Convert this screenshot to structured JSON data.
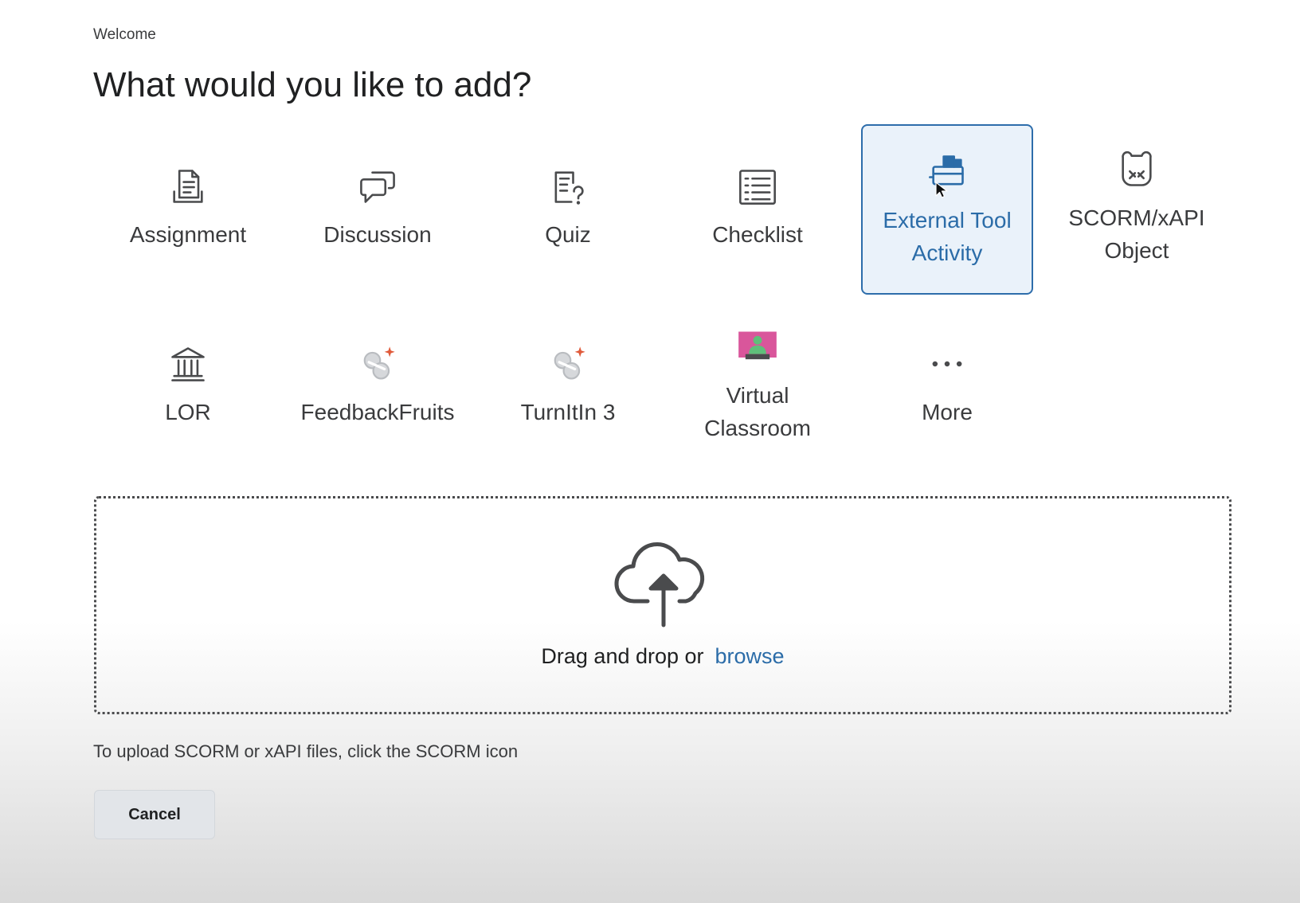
{
  "breadcrumb": "Welcome",
  "title": "What would you like to add?",
  "tiles": [
    {
      "label": "Assignment",
      "icon": "assignment-icon",
      "selected": false
    },
    {
      "label": "Discussion",
      "icon": "discussion-icon",
      "selected": false
    },
    {
      "label": "Quiz",
      "icon": "quiz-icon",
      "selected": false
    },
    {
      "label": "Checklist",
      "icon": "checklist-icon",
      "selected": false
    },
    {
      "label": "External Tool\nActivity",
      "icon": "external-tool-icon",
      "selected": true
    },
    {
      "label": "SCORM/xAPI\nObject",
      "icon": "scorm-icon",
      "selected": false
    },
    {
      "label": "LOR",
      "icon": "lor-icon",
      "selected": false
    },
    {
      "label": "FeedbackFruits",
      "icon": "plugin-icon",
      "selected": false
    },
    {
      "label": "TurnItIn 3",
      "icon": "plugin-icon",
      "selected": false
    },
    {
      "label": "Virtual\nClassroom",
      "icon": "virtual-classroom-icon",
      "selected": false
    },
    {
      "label": "More",
      "icon": "more-icon",
      "selected": false
    }
  ],
  "upload": {
    "drag_text": "Drag and drop or",
    "browse_label": "browse",
    "icon": "cloud-upload-icon"
  },
  "hint": "To upload SCORM or xAPI files, click the SCORM icon",
  "cancel_label": "Cancel",
  "colors": {
    "accent": "#2b6ca8",
    "selected_bg": "#eaf2fa",
    "button_bg": "#e2e5e9"
  }
}
